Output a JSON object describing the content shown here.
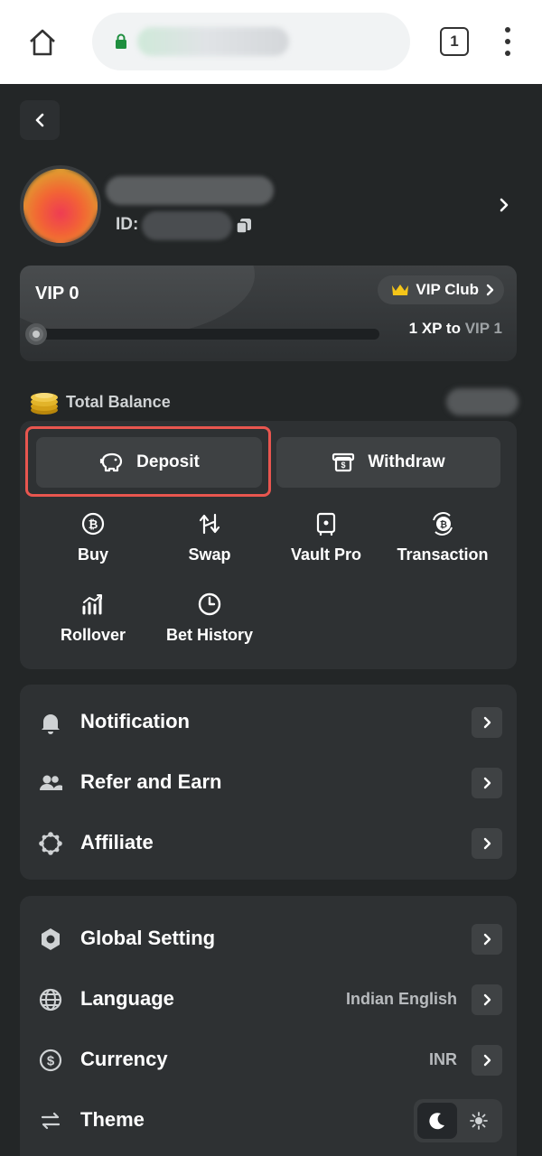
{
  "browser": {
    "tab_count": "1"
  },
  "profile": {
    "id_label": "ID:"
  },
  "vip": {
    "level": "VIP 0",
    "club_label": "VIP Club",
    "xp_amount": "1 XP to",
    "next_level": "VIP 1",
    "progress": 0
  },
  "balance": {
    "label": "Total Balance"
  },
  "wallet": {
    "deposit_label": "Deposit",
    "withdraw_label": "Withdraw",
    "actions": [
      {
        "label": "Buy",
        "icon": "bitcoin-coin-icon"
      },
      {
        "label": "Swap",
        "icon": "swap-arrows-icon"
      },
      {
        "label": "Vault Pro",
        "icon": "vault-icon"
      },
      {
        "label": "Transaction",
        "icon": "coin-exchange-icon"
      },
      {
        "label": "Rollover",
        "icon": "rollover-chart-icon"
      },
      {
        "label": "Bet History",
        "icon": "clock-icon"
      }
    ]
  },
  "menu": {
    "notification": "Notification",
    "refer": "Refer and Earn",
    "affiliate": "Affiliate"
  },
  "settings": {
    "global": "Global Setting",
    "language": "Language",
    "language_value": "Indian English",
    "currency": "Currency",
    "currency_value": "INR",
    "theme": "Theme",
    "theme_selected": "dark"
  },
  "colors": {
    "background": "#232627",
    "panel": "#2e3133",
    "highlight": "#e8564f",
    "crown": "#f5c518"
  }
}
